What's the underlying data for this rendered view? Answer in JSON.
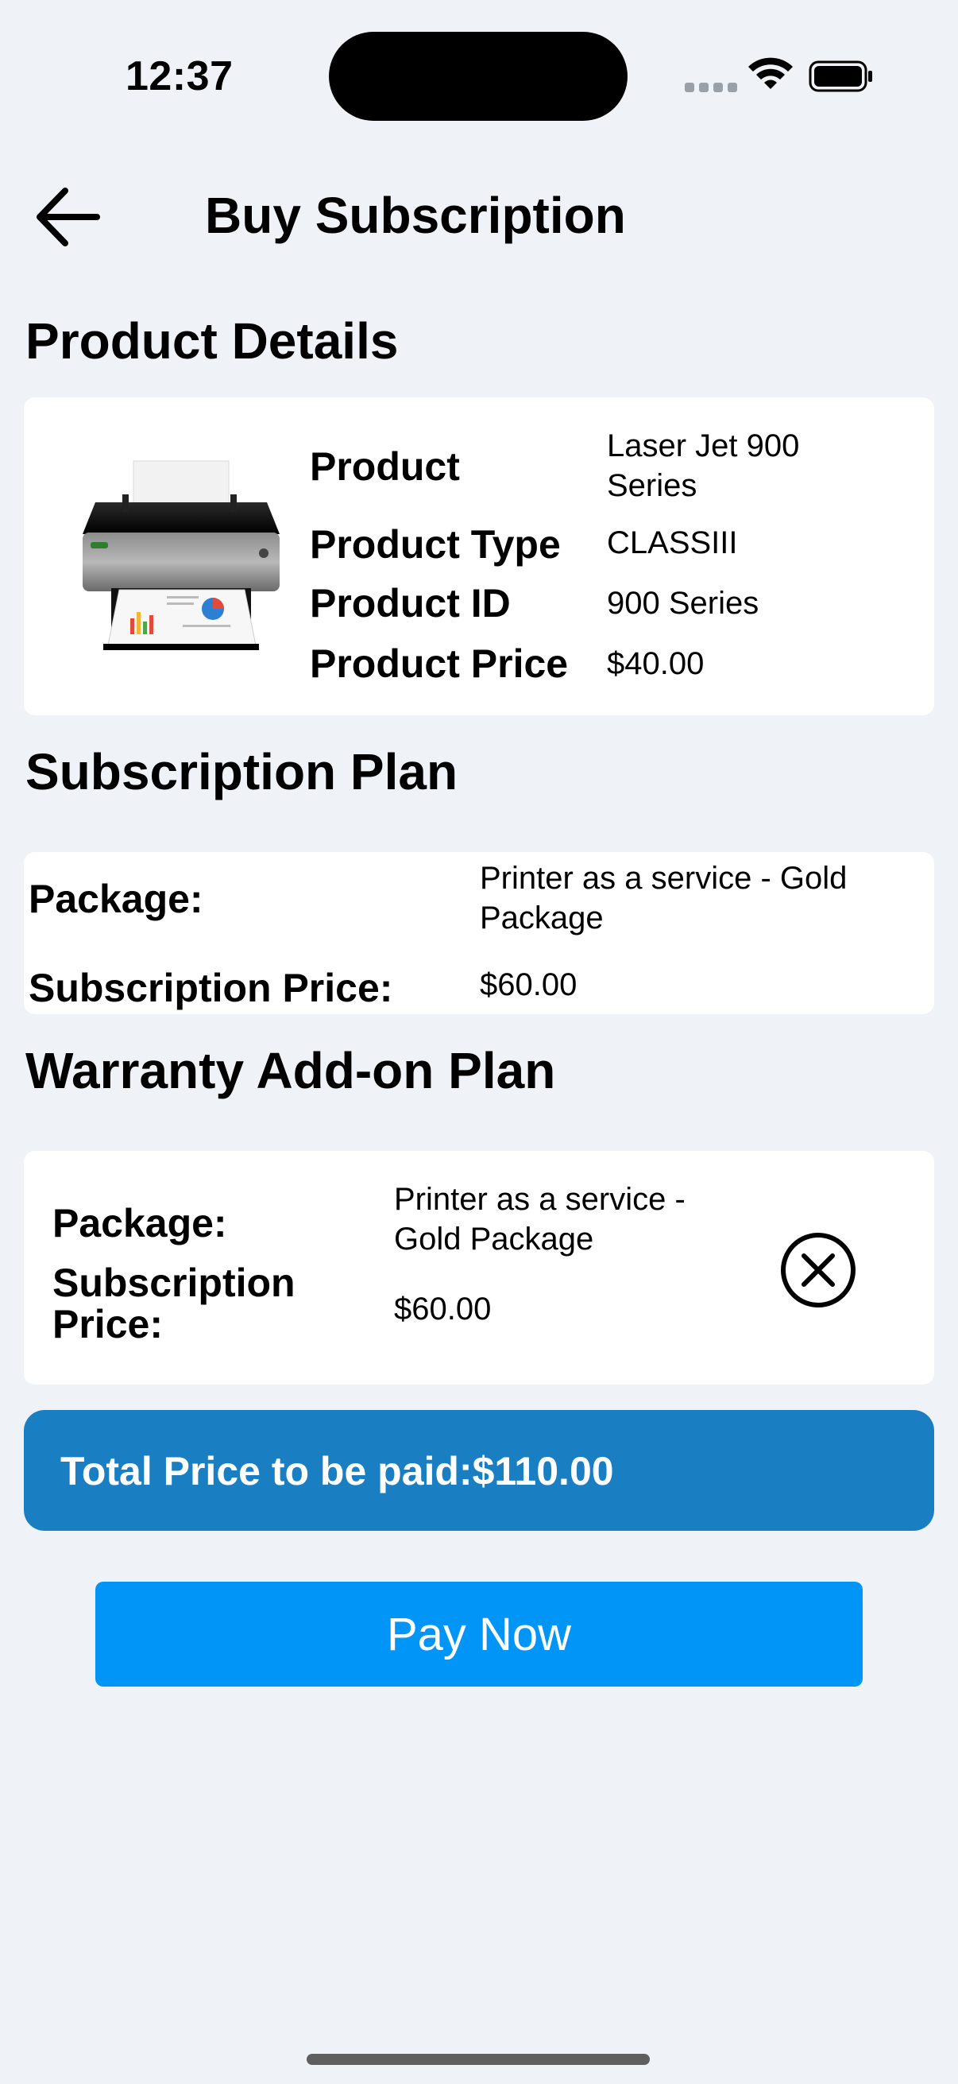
{
  "status_bar": {
    "time": "12:37"
  },
  "header": {
    "title": "Buy Subscription",
    "back_icon": "arrow-left-icon"
  },
  "product_section": {
    "title": "Product Details",
    "image_icon": "printer-icon",
    "rows": [
      {
        "label": "Product",
        "value": "Laser Jet 900 Series"
      },
      {
        "label": "Product Type",
        "value": "CLASSIII"
      },
      {
        "label": "Product ID",
        "value": "900 Series"
      },
      {
        "label": "Product Price",
        "value": "$40.00"
      }
    ]
  },
  "subscription_section": {
    "title": "Subscription Plan",
    "package_label": "Package:",
    "package_value": "Printer as a service - Gold Package",
    "price_label": "Subscription Price:",
    "price_value": "$60.00"
  },
  "warranty_section": {
    "title": "Warranty Add-on Plan",
    "package_label": "Package:",
    "package_value": "Printer as a service - Gold Package",
    "price_label": "Subscription Price:",
    "price_value": "$60.00",
    "remove_icon": "close-circle-icon"
  },
  "total": {
    "text": "Total Price to be paid:$110.00"
  },
  "pay_button": {
    "label": "Pay Now"
  },
  "colors": {
    "background": "#eff2f7",
    "total_bar": "#1a7fc2",
    "pay_button": "#0095f6"
  }
}
